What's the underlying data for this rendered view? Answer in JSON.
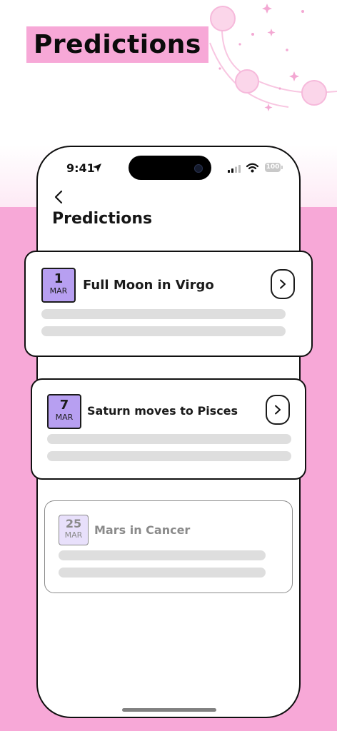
{
  "promo": {
    "headline": "Predictions"
  },
  "status_bar": {
    "time": "9:41",
    "battery": "100"
  },
  "screen": {
    "title": "Predictions"
  },
  "predictions": [
    {
      "day": "1",
      "month": "MAR",
      "title": "Full Moon in Virgo"
    },
    {
      "day": "7",
      "month": "MAR",
      "title": "Saturn moves to Pisces"
    },
    {
      "day": "25",
      "month": "MAR",
      "title": "Mars in Cancer"
    }
  ],
  "colors": {
    "accent_pink": "#f7a8d7",
    "date_purple": "#b79ff1"
  }
}
